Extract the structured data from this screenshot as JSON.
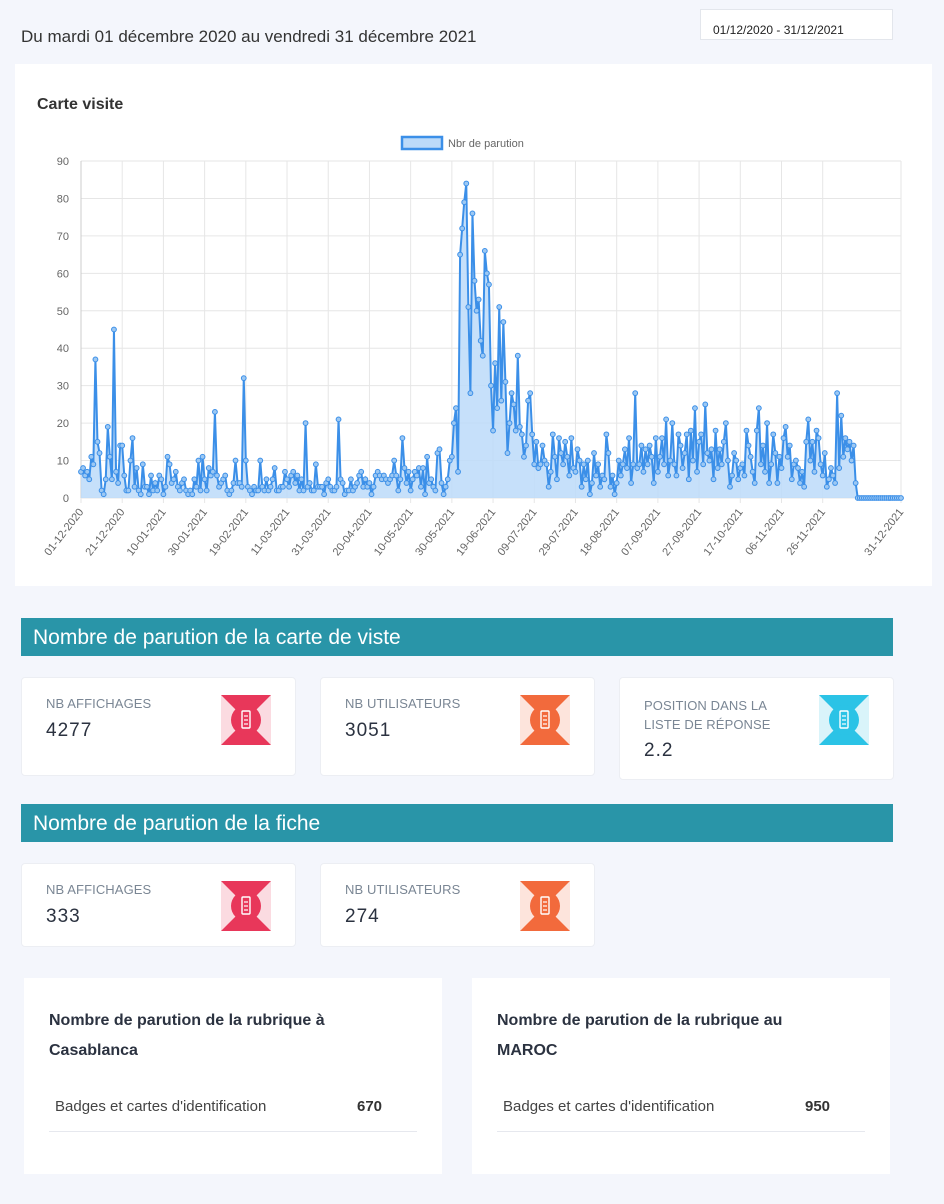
{
  "header": {
    "range_text": "Du mardi 01 décembre 2020 au vendredi 31 décembre 2021",
    "date_input_value": "01/12/2020 - 31/12/2021"
  },
  "chart_card": {
    "title": "Carte visite"
  },
  "chart_data": {
    "type": "area",
    "legend": [
      "Nbr de parution"
    ],
    "legend_position": "top-center",
    "grid": true,
    "ylim": [
      0,
      90
    ],
    "yticks": [
      0,
      10,
      20,
      30,
      40,
      50,
      60,
      70,
      80,
      90
    ],
    "xtick_labels": [
      "01-12-2020",
      "21-12-2020",
      "10-01-2021",
      "30-01-2021",
      "19-02-2021",
      "11-03-2021",
      "31-03-2021",
      "20-04-2021",
      "10-05-2021",
      "30-05-2021",
      "19-06-2021",
      "09-07-2021",
      "29-07-2021",
      "18-08-2021",
      "07-09-2021",
      "27-09-2021",
      "17-10-2021",
      "06-11-2021",
      "26-11-2021",
      "31-12-2021"
    ],
    "series": [
      {
        "name": "Nbr de parution",
        "color": "#3b8fe8",
        "values": [
          7,
          8,
          6,
          7,
          5,
          11,
          9,
          37,
          15,
          12,
          2,
          1,
          5,
          19,
          11,
          5,
          45,
          7,
          4,
          14,
          14,
          6,
          2,
          2,
          10,
          16,
          3,
          8,
          2,
          1,
          9,
          3,
          3,
          1,
          6,
          2,
          4,
          2,
          6,
          5,
          1,
          3,
          11,
          9,
          4,
          5,
          7,
          3,
          2,
          4,
          5,
          2,
          1,
          2,
          1,
          5,
          3,
          10,
          2,
          11,
          5,
          2,
          8,
          6,
          7,
          23,
          6,
          3,
          4,
          5,
          6,
          2,
          1,
          2,
          4,
          10,
          4,
          4,
          3,
          32,
          10,
          3,
          2,
          1,
          3,
          2,
          2,
          10,
          3,
          2,
          5,
          2,
          3,
          5,
          8,
          2,
          2,
          3,
          3,
          7,
          5,
          3,
          6,
          7,
          4,
          6,
          2,
          5,
          2,
          20,
          3,
          4,
          2,
          2,
          9,
          3,
          3,
          3,
          1,
          4,
          5,
          3,
          2,
          2,
          3,
          21,
          5,
          4,
          1,
          2,
          2,
          5,
          2,
          3,
          4,
          6,
          7,
          3,
          5,
          3,
          4,
          1,
          3,
          6,
          7,
          6,
          5,
          6,
          5,
          4,
          5,
          6,
          10,
          6,
          2,
          5,
          16,
          8,
          4,
          7,
          2,
          5,
          7,
          6,
          8,
          3,
          8,
          1,
          11,
          4,
          5,
          3,
          2,
          12,
          13,
          4,
          1,
          3,
          5,
          10,
          11,
          20,
          24,
          7,
          65,
          72,
          79,
          84,
          51,
          28,
          76,
          58,
          50,
          53,
          42,
          38,
          66,
          60,
          57,
          30,
          18,
          36,
          24,
          51,
          26,
          47,
          31,
          12,
          20,
          28,
          25,
          18,
          38,
          19,
          17,
          11,
          14,
          26,
          28,
          17,
          9,
          15,
          8,
          9,
          14,
          10,
          9,
          3,
          7,
          17,
          11,
          5,
          16,
          12,
          9,
          15,
          11,
          6,
          16,
          8,
          7,
          13,
          10,
          3,
          9,
          5,
          10,
          1,
          4,
          12,
          6,
          9,
          3,
          6,
          5,
          17,
          12,
          3,
          6,
          1,
          4,
          10,
          6,
          9,
          13,
          8,
          16,
          4,
          9,
          28,
          8,
          9,
          14,
          7,
          13,
          9,
          14,
          11,
          4,
          16,
          7,
          11,
          16,
          9,
          21,
          6,
          10,
          20,
          9,
          6,
          17,
          14,
          8,
          12,
          17,
          5,
          18,
          10,
          24,
          7,
          15,
          17,
          9,
          25,
          12,
          10,
          13,
          5,
          18,
          8,
          13,
          9,
          15,
          20,
          10,
          3,
          6,
          12,
          10,
          5,
          8,
          9,
          6,
          18,
          14,
          11,
          7,
          4,
          18,
          24,
          9,
          14,
          7,
          20,
          4,
          9,
          17,
          12,
          4,
          11,
          8,
          16,
          19,
          11,
          14,
          5,
          9,
          10,
          8,
          4,
          7,
          3,
          15,
          21,
          10,
          15,
          7,
          18,
          16,
          9,
          6,
          12,
          3,
          5,
          8,
          6,
          4,
          28,
          8,
          22,
          11,
          16,
          13,
          15,
          10,
          14,
          4,
          0,
          0,
          0,
          0,
          0,
          0,
          0,
          0,
          0,
          0,
          0,
          0,
          0,
          0,
          0,
          0,
          0,
          0,
          0,
          0,
          0,
          0
        ]
      }
    ]
  },
  "section_carte": {
    "title": "Nombre de parution de la carte de viste",
    "stats": [
      {
        "label": "NB AFFICHAGES",
        "value": "4277",
        "icon": "badge-icon",
        "color": "#e8375a"
      },
      {
        "label": "NB UTILISATEURS",
        "value": "3051",
        "icon": "badge-icon",
        "color": "#f26a3c"
      },
      {
        "label": "POSITION DANS LA LISTE DE RÉPONSE",
        "value": "2.2",
        "icon": "badge-icon",
        "color": "#2bc3e6"
      }
    ]
  },
  "section_fiche": {
    "title": "Nombre de parution de la fiche",
    "stats": [
      {
        "label": "NB AFFICHAGES",
        "value": "333",
        "icon": "badge-icon",
        "color": "#e8375a"
      },
      {
        "label": "NB UTILISATEURS",
        "value": "274",
        "icon": "badge-icon",
        "color": "#f26a3c"
      }
    ]
  },
  "rubriques": [
    {
      "title": "Nombre de parution de la rubrique à Casablanca",
      "row_label": "Badges et cartes d'identification",
      "row_value": "670"
    },
    {
      "title": "Nombre de parution de la rubrique au MAROC",
      "row_label": "Badges et cartes d'identification",
      "row_value": "950"
    }
  ]
}
